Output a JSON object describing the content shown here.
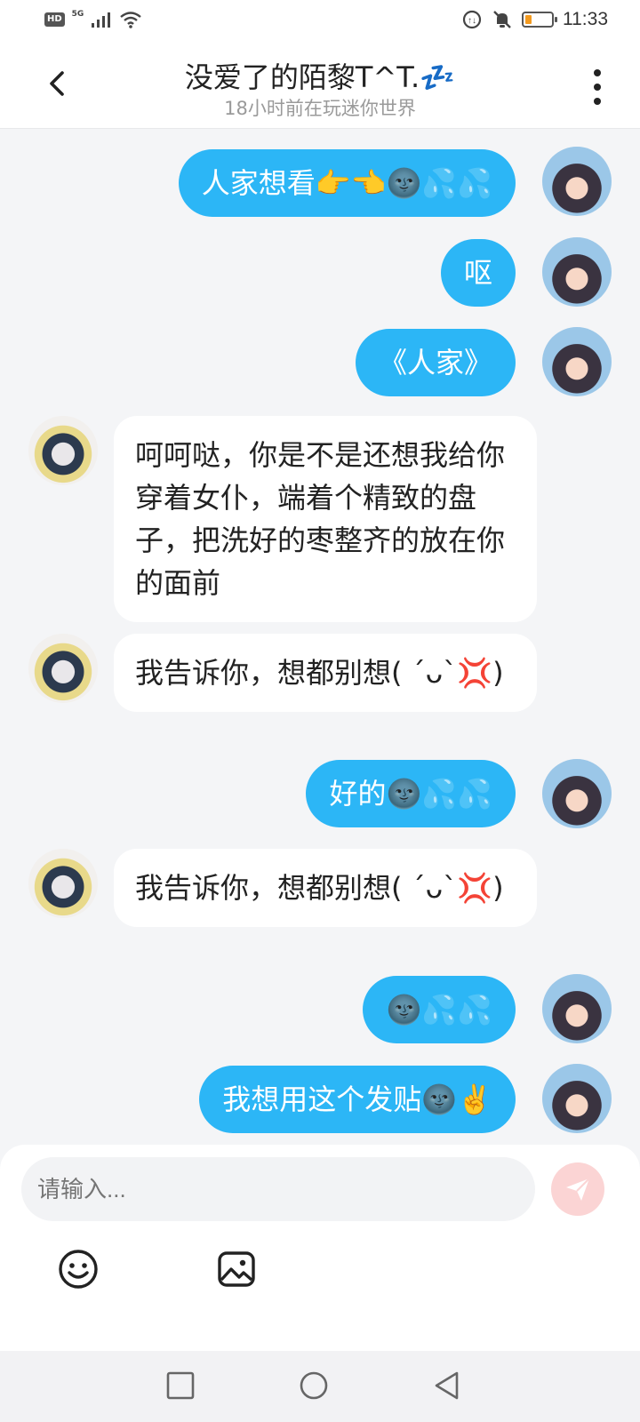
{
  "status_bar": {
    "hd": "HD",
    "network": "5G",
    "time": "11:33",
    "battery_level": 0.25,
    "icons": [
      "signal-icon",
      "wifi-icon",
      "data-saver-icon",
      "mute-icon",
      "battery-icon"
    ]
  },
  "header": {
    "title": "没爱了的陌黎T^T.💤",
    "subtitle": "18小时前在玩迷你世界"
  },
  "messages": [
    {
      "side": "me",
      "text": "人家想看👉👈🌚💦💦"
    },
    {
      "side": "me",
      "text": "呕"
    },
    {
      "side": "me",
      "text": "《人家》"
    },
    {
      "side": "other",
      "text": "呵呵哒，你是不是还想我给你穿着女仆，端着个精致的盘子，把洗好的枣整齐的放在你的面前"
    },
    {
      "side": "other",
      "text": "我告诉你，想都别想( ´ᴗ`💢)"
    },
    {
      "side": "me",
      "text": "好的🌚💦💦"
    },
    {
      "side": "other",
      "text": "我告诉你，想都别想( ´ᴗ`💢)"
    },
    {
      "side": "me",
      "text": "🌚💦💦"
    },
    {
      "side": "me",
      "text": "我想用这个发贴🌚✌️"
    }
  ],
  "composer": {
    "placeholder": "请输入...",
    "tools": [
      "emoji-icon",
      "image-icon"
    ]
  },
  "colors": {
    "my_bubble": "#2cb6f6",
    "other_bubble": "#ffffff",
    "background": "#f4f5f7",
    "send_button": "#fbd4d4"
  }
}
